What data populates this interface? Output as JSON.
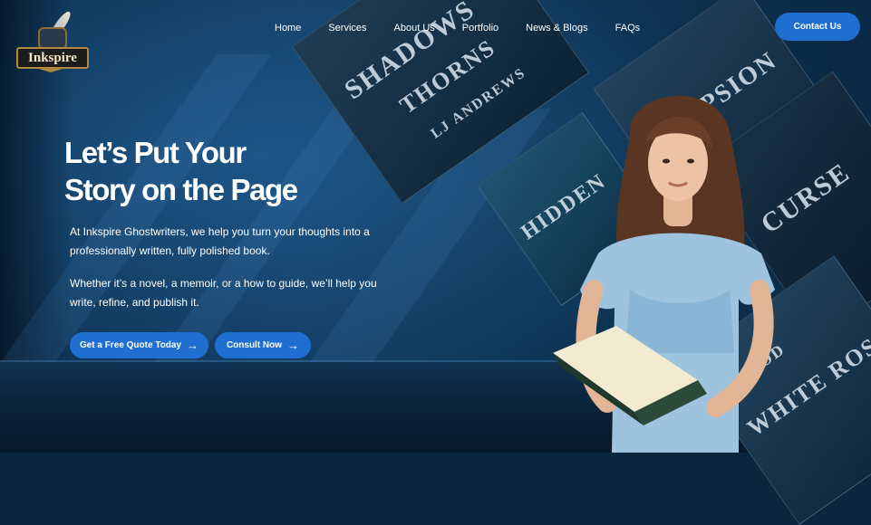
{
  "brand": {
    "logo_text": "Inkspire"
  },
  "nav": {
    "items": [
      {
        "label": "Home"
      },
      {
        "label": "Services"
      },
      {
        "label": "About Us"
      },
      {
        "label": "Portfolio"
      },
      {
        "label": "News & Blogs"
      },
      {
        "label": "FAQs"
      }
    ],
    "contact_label": "Contact Us"
  },
  "hero": {
    "title_line1": "Let’s Put Your",
    "title_line2": "Story on the Page",
    "paragraph1": "At Inkspire Ghostwriters, we help you turn your thoughts into a professionally written, fully polished book.",
    "paragraph2": "Whether it’s a novel, a memoir, or a how to guide, we’ll help you write, refine, and publish it.",
    "quote_button": "Get a Free Quote Today",
    "consult_button": "Consult Now",
    "arrow": "→"
  },
  "covers": {
    "c1_title": "SHADOWS",
    "c1_sub": "THORNS",
    "c1_author": "LJ ANDREWS",
    "c2_title": "ECLIPSION",
    "c3_title": "CURSE",
    "c4_title": "HIDDEN",
    "c5_title": "WHITE ROSE",
    "c5_author": "WOOD"
  },
  "colors": {
    "accent": "#1f6fd1",
    "background": "#0d3050"
  }
}
